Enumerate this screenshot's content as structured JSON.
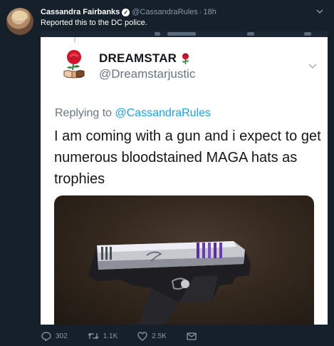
{
  "tweet": {
    "author_name": "Cassandra Fairbanks",
    "author_handle": "@CassandraRules",
    "separator": "·",
    "time": "18h",
    "text": "Reported this to the DC police."
  },
  "screenshot": {
    "sender_name": "DREAMSTAR",
    "sender_handle": "@Dreamstarjustic",
    "replying_prefix": "Replying to",
    "replying_handle": "@CassandraRules",
    "body": "I am coming with a gun and i expect to get numerous bloodstained MAGA hats as trophies",
    "image_subject": "silver pistol on brown carpet"
  },
  "actions": {
    "reply_count": "302",
    "retweet_count": "1.1K",
    "like_count": "2.5K"
  },
  "icons": [
    "verified-badge-icon",
    "chevron-down-icon",
    "rose-fist-logo-icon",
    "rose-icon",
    "reply-icon",
    "retweet-icon",
    "like-icon",
    "direct-message-icon"
  ],
  "colors": {
    "background": "#15202b",
    "muted": "#8899a6",
    "link": "#1da1f2"
  }
}
